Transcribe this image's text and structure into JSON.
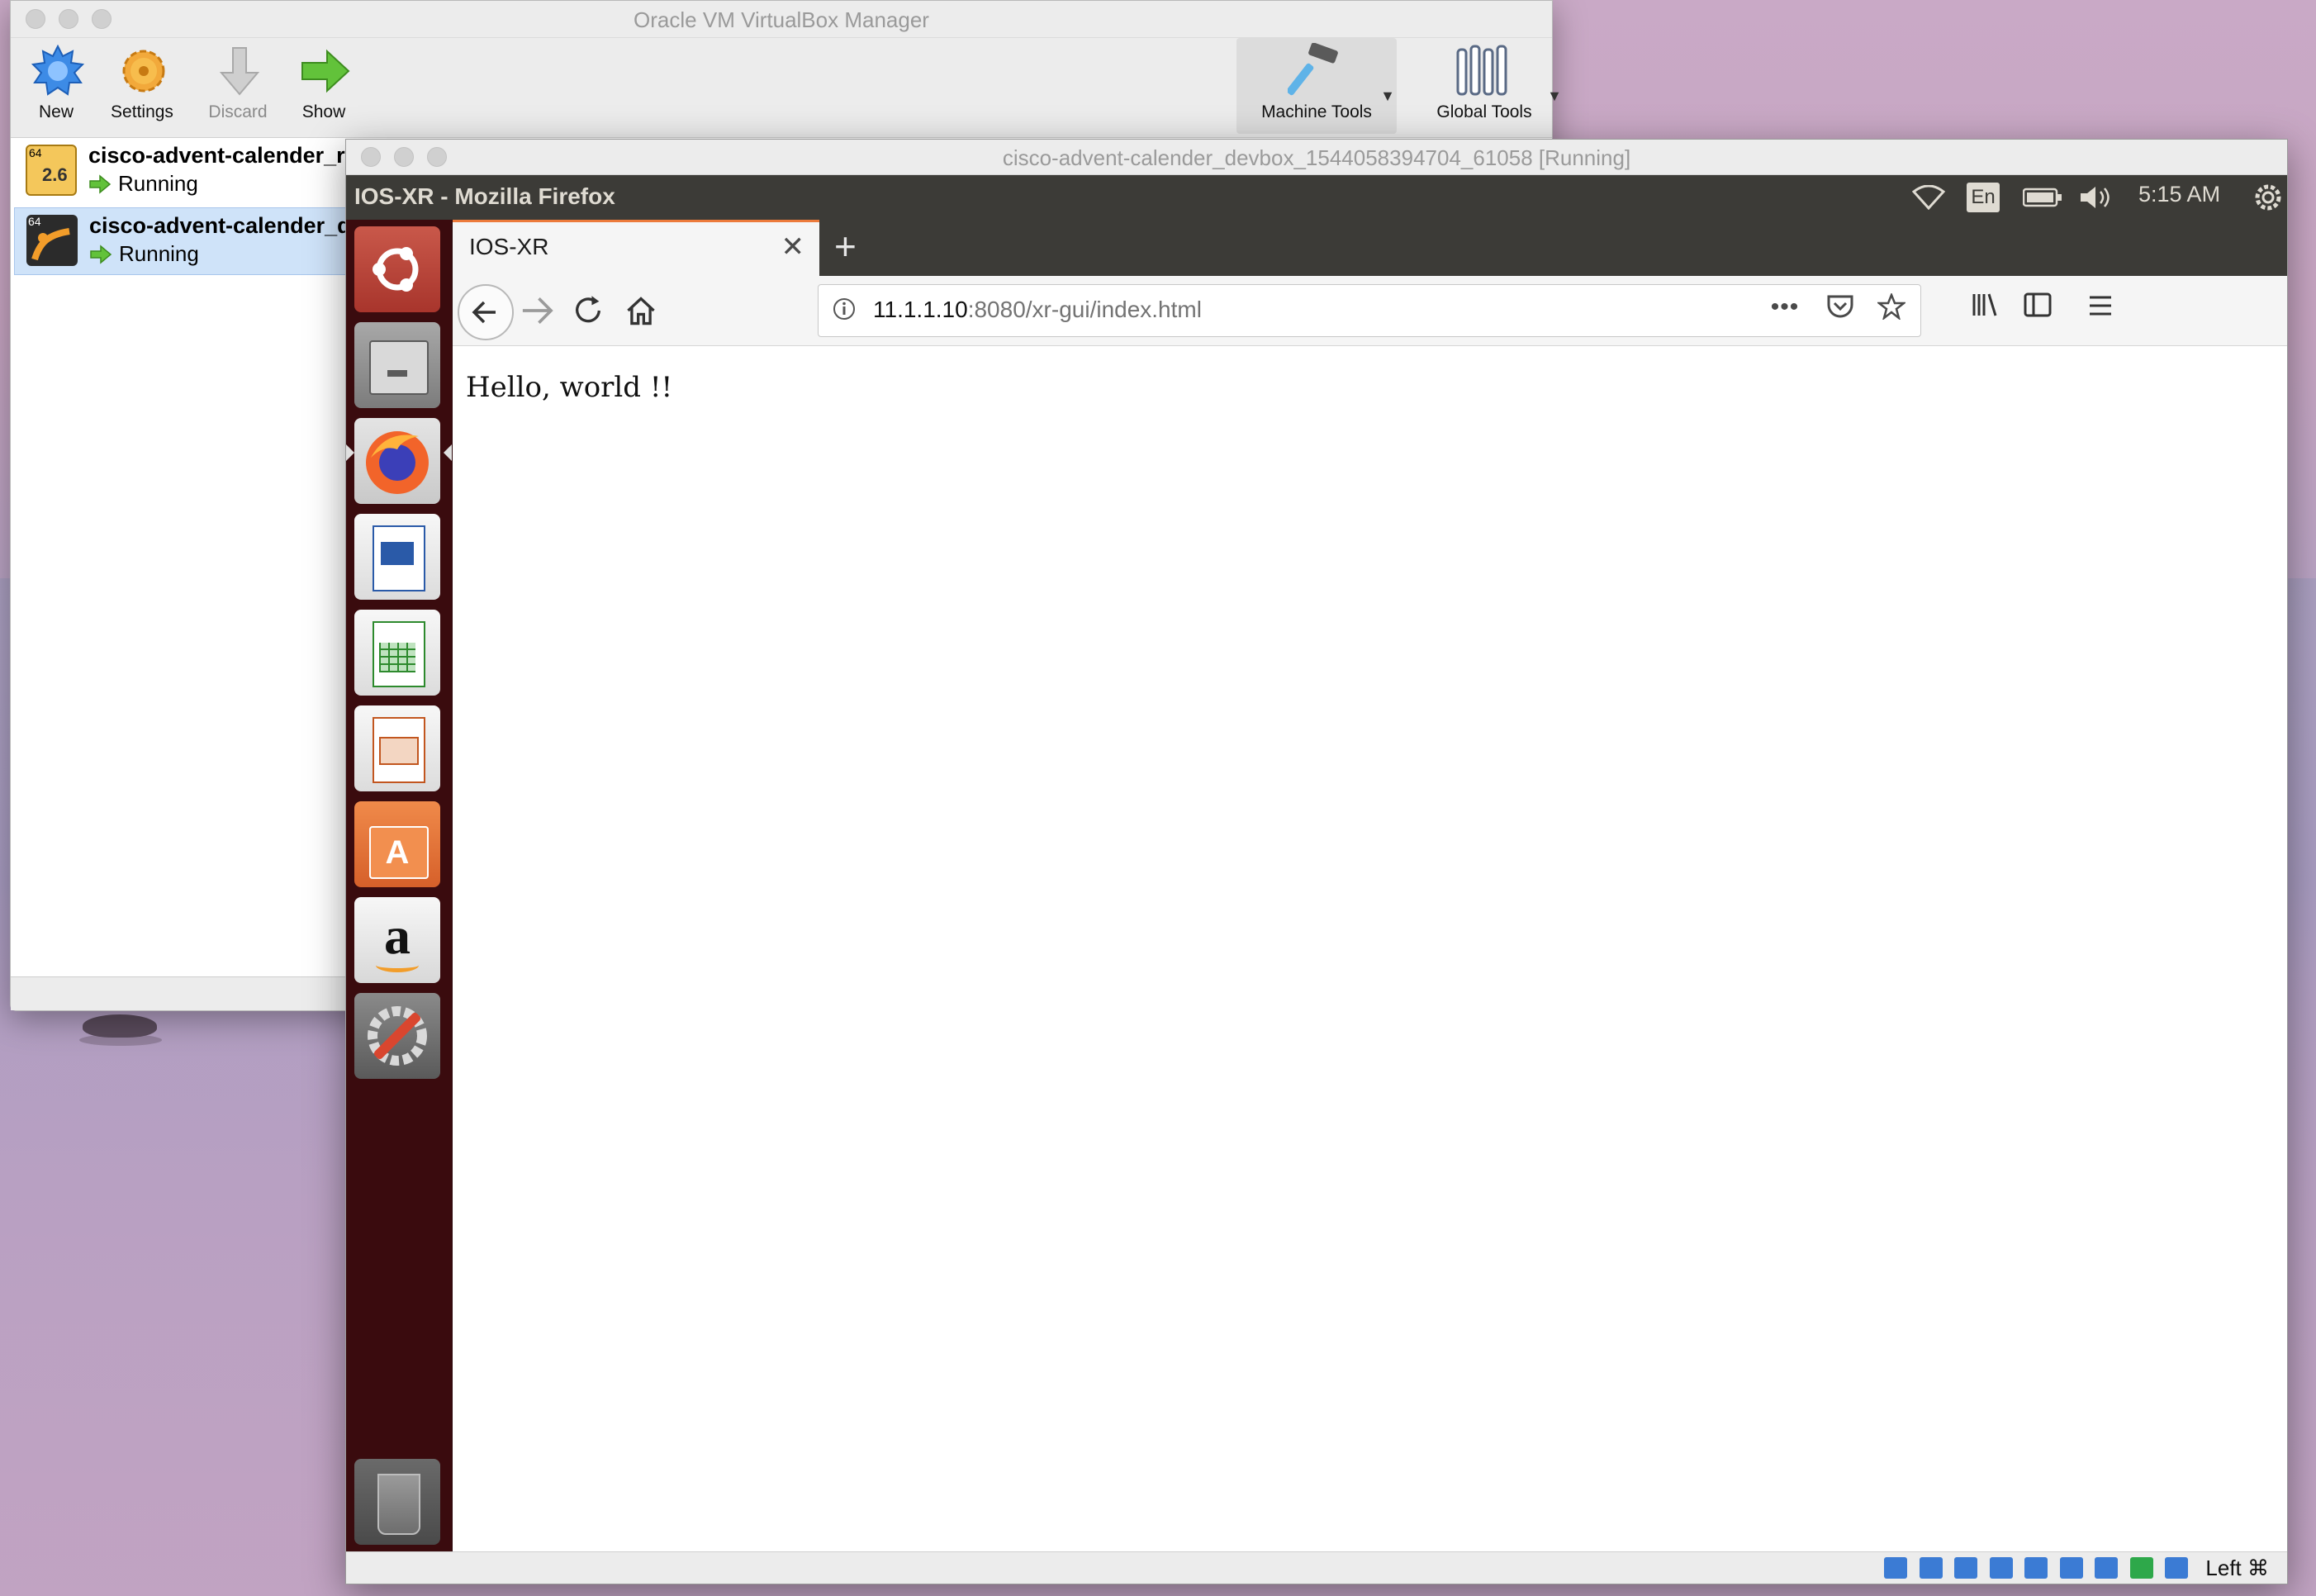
{
  "manager": {
    "title": "Oracle VM VirtualBox Manager",
    "toolbar": {
      "new_label": "New",
      "settings_label": "Settings",
      "discard_label": "Discard",
      "show_label": "Show",
      "machine_tools_label": "Machine Tools",
      "global_tools_label": "Global Tools"
    },
    "vms": [
      {
        "name": "cisco-advent-calender_r",
        "badge": "2.6",
        "arch": "64",
        "status": "Running"
      },
      {
        "name": "cisco-advent-calender_d",
        "arch": "64",
        "status": "Running"
      }
    ]
  },
  "vm_window": {
    "title": "cisco-advent-calender_devbox_1544058394704_61058 [Running]",
    "host_key": "Left ⌘"
  },
  "ubuntu": {
    "window_title": "IOS-XR - Mozilla Firefox",
    "keyboard": "En",
    "clock": "5:15 AM"
  },
  "launcher": [
    "ubuntu-dash-icon",
    "files-icon",
    "firefox-icon",
    "writer-icon",
    "calc-icon",
    "impress-icon",
    "software-center-icon",
    "amazon-icon",
    "system-settings-icon",
    "trash-icon"
  ],
  "firefox": {
    "tab_title": "IOS-XR",
    "url_host": "11.1.1.10",
    "url_rest": ":8080/xr-gui/index.html",
    "page_text": "Hello, world !!"
  },
  "colors": {
    "launcher_bg": "#3a0b0e",
    "panel_bg": "#3c3b37",
    "tab_accent": "#ec7a3b",
    "selected_vm": "#cfe3f9"
  }
}
